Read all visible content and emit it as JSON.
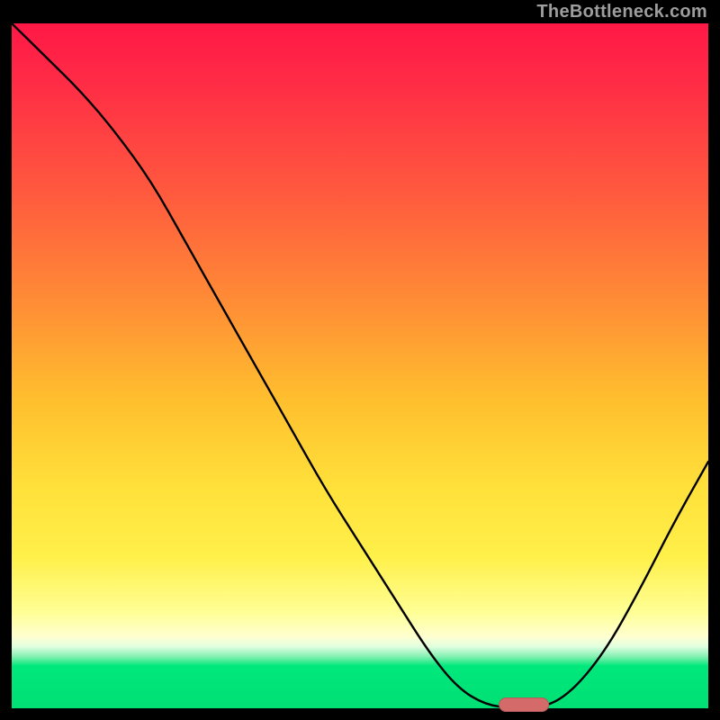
{
  "watermark": "TheBottleneck.com",
  "colors": {
    "marker": "#d46a6a",
    "curve": "#000000"
  },
  "chart_data": {
    "type": "line",
    "title": "",
    "xlabel": "",
    "ylabel": "",
    "xlim": [
      0,
      1
    ],
    "ylim": [
      0,
      1
    ],
    "x": [
      0.0,
      0.05,
      0.1,
      0.15,
      0.2,
      0.25,
      0.3,
      0.35,
      0.4,
      0.45,
      0.5,
      0.55,
      0.6,
      0.64,
      0.68,
      0.72,
      0.76,
      0.8,
      0.85,
      0.9,
      0.95,
      1.0
    ],
    "values": [
      1.0,
      0.95,
      0.9,
      0.84,
      0.77,
      0.68,
      0.59,
      0.5,
      0.41,
      0.32,
      0.24,
      0.16,
      0.08,
      0.03,
      0.005,
      0.0,
      0.0,
      0.02,
      0.08,
      0.17,
      0.27,
      0.36
    ],
    "marker": {
      "x_center": 0.735,
      "y": 0.0,
      "width": 0.072,
      "label": ""
    },
    "grid": false,
    "legend": false
  }
}
